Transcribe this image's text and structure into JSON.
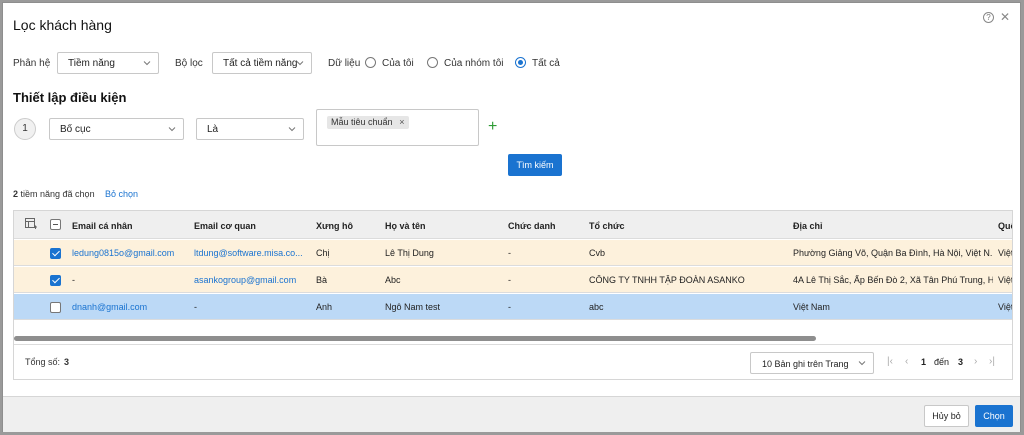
{
  "dialog": {
    "title": "Lọc khách hàng"
  },
  "filters": {
    "phan_he_label": "Phân hệ",
    "phan_he_value": "Tiềm năng",
    "bo_loc_label": "Bộ lọc",
    "bo_loc_value": "Tất cả tiềm năng",
    "du_lieu_label": "Dữ liệu",
    "radios": [
      {
        "label": "Của tôi",
        "checked": false
      },
      {
        "label": "Của nhóm tôi",
        "checked": false
      },
      {
        "label": "Tất cả",
        "checked": true
      }
    ]
  },
  "conditions": {
    "heading": "Thiết lập điều kiện",
    "step": "1",
    "field": "Bố cục",
    "operator": "Là",
    "tag": "Mẫu tiêu chuẩn",
    "tag_remove": "×",
    "add": "+",
    "search_label": "Tìm kiếm"
  },
  "selection": {
    "count": "2",
    "text": " tiềm năng đã chọn",
    "unselect_label": "Bỏ chọn"
  },
  "grid": {
    "columns": [
      "Email cá nhân",
      "Email cơ quan",
      "Xưng hô",
      "Họ và tên",
      "Chức danh",
      "Tổ chức",
      "Địa chỉ",
      "Quốc"
    ],
    "rows": [
      {
        "checked": true,
        "email": "ledung0815o@gmail.com",
        "work_email": "ltdung@software.misa.co...",
        "salutation": "Chị",
        "name": "Lê Thị Dung",
        "title": "-",
        "org": "Cvb",
        "address": "Phường Giảng Võ, Quận Ba Đình, Hà Nội, Việt N...",
        "country": "Việt"
      },
      {
        "checked": true,
        "email": "-",
        "work_email": "asankogroup@gmail.com",
        "salutation": "Bà",
        "name": "Abc",
        "title": "-",
        "org": "CÔNG TY TNHH TẬP ĐOÀN ASANKO",
        "address": "4A Lê Thị Sắc, Ấp Bến Đò 2, Xã Tân Phú Trung, H...",
        "country": "Việt"
      },
      {
        "checked": false,
        "email": "dnanh@gmail.com",
        "work_email": "-",
        "salutation": "Anh",
        "name": "Ngô Nam test",
        "title": "-",
        "org": "abc",
        "address": "Việt Nam",
        "country": "Việt"
      }
    ],
    "total_label": "Tổng số:",
    "total_value": "3",
    "page_size": "10 Bản ghi trên Trang",
    "page_from": "1",
    "page_to_label": "đến",
    "page_to": "3"
  },
  "footer": {
    "cancel_label": "Hủy bỏ",
    "choose_label": "Chọn"
  },
  "colors": {
    "accent": "#1a73d0",
    "selected_row": "#fdf1dc",
    "hover_row": "#bcd9f6",
    "add_icon": "#2e9b35"
  }
}
